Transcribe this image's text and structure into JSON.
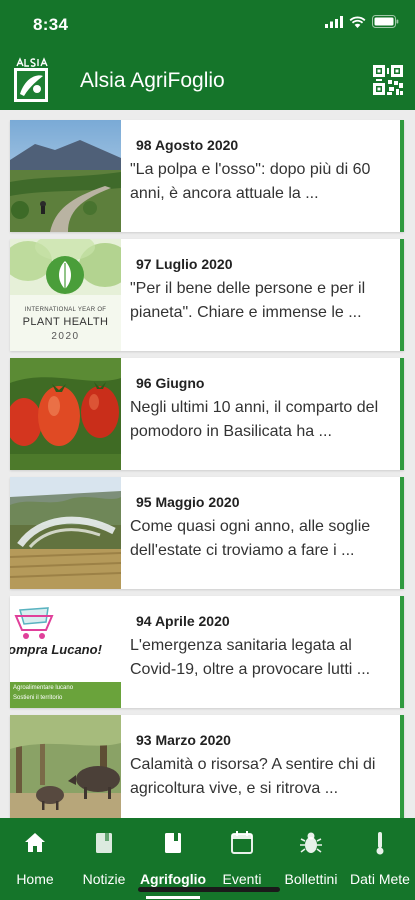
{
  "status_bar": {
    "time": "8:34",
    "icons": [
      "signal-icon",
      "wifi-icon",
      "battery-icon"
    ]
  },
  "app_bar": {
    "title": "Alsia AgriFoglio",
    "logo_icon": "alsia-logo-icon",
    "action_icon": "qr-code-icon"
  },
  "articles": [
    {
      "date": "98 Agosto 2020",
      "excerpt": "\"La polpa e l'osso\": dopo più di 60 anni, è ancora attuale la ...",
      "thumb": "landscape-cyclist"
    },
    {
      "date": "97 Luglio 2020",
      "excerpt": "\"Per il bene delle persone e per il pianeta\". Chiare e immense le ...",
      "thumb": "plant-health-2020",
      "thumb_text": {
        "line1": "INTERNATIONAL YEAR OF",
        "line2": "PLANT HEALTH",
        "line3": "2020"
      }
    },
    {
      "date": "96 Giugno",
      "excerpt": "Negli ultimi 10 anni, il comparto del pomodoro in Basilicata ha ...",
      "thumb": "tomatoes"
    },
    {
      "date": "95 Maggio 2020",
      "excerpt": "Come quasi ogni anno, alle soglie dell'estate ci troviamo a fare i ...",
      "thumb": "irrigation-field"
    },
    {
      "date": "94 Aprile 2020",
      "excerpt": "L'emergenza sanitaria legata al Covid-19, oltre a provocare lutti ...",
      "thumb": "compra-lucano",
      "thumb_text": {
        "line1": "ompra Lucano!",
        "line2": "Agroalimentare lucano",
        "line3": "Sostieni il territorio"
      }
    },
    {
      "date": "93 Marzo 2020",
      "excerpt": "Calamità o risorsa? A sentire chi di agricoltura vive, e si ritrova ...",
      "thumb": "wild-boars"
    }
  ],
  "tabs": [
    {
      "label": "Home",
      "icon": "home-icon",
      "active": false
    },
    {
      "label": "Notizie",
      "icon": "book-icon",
      "active": false
    },
    {
      "label": "Agrifoglio",
      "icon": "book-icon",
      "active": true
    },
    {
      "label": "Eventi",
      "icon": "calendar-icon",
      "active": false
    },
    {
      "label": "Bollettini",
      "icon": "bug-icon",
      "active": false
    },
    {
      "label": "Dati Mete",
      "icon": "thermometer-icon",
      "active": false
    }
  ],
  "colors": {
    "primary": "#15752a",
    "accent": "#2f9a3f"
  }
}
